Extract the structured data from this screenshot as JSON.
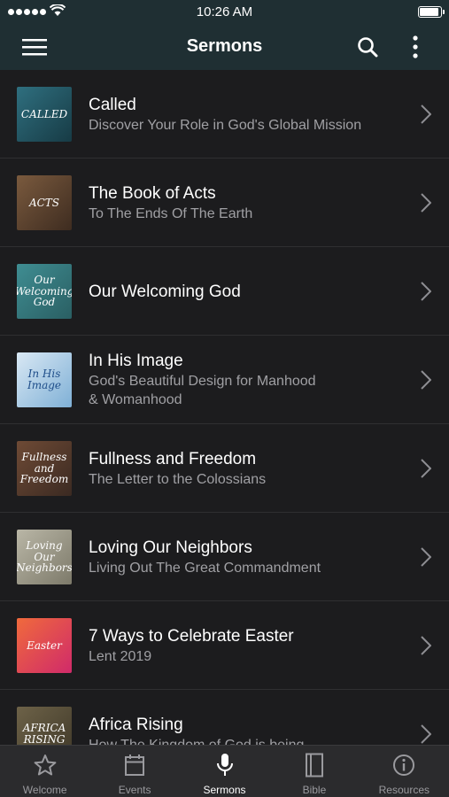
{
  "status_bar": {
    "time": "10:26 AM",
    "battery_level": 0.95
  },
  "header": {
    "title": "Sermons"
  },
  "sermons": [
    {
      "title": "Called",
      "subtitle": "Discover Your Role in God's Global Mission",
      "thumb_text": "CALLED",
      "thumb_colors": [
        "#2f6f7f",
        "#173b45"
      ]
    },
    {
      "title": "The Book of Acts",
      "subtitle": "To The Ends Of The Earth",
      "thumb_text": "ACTS",
      "thumb_colors": [
        "#7a5a3e",
        "#3e2c20"
      ]
    },
    {
      "title": "Our Welcoming God",
      "subtitle": "",
      "thumb_text": "Our Welcoming God",
      "thumb_colors": [
        "#3f8d92",
        "#2a5f63"
      ]
    },
    {
      "title": "In His Image",
      "subtitle": "God's Beautiful Design for Manhood\n& Womanhood",
      "thumb_text": "In His Image",
      "thumb_colors": [
        "#d9e8f4",
        "#7fb0d6"
      ]
    },
    {
      "title": "Fullness and Freedom",
      "subtitle": "The Letter to the Colossians",
      "thumb_text": "Fullness and Freedom",
      "thumb_colors": [
        "#6e4a35",
        "#3b2a22"
      ]
    },
    {
      "title": "Loving Our Neighbors",
      "subtitle": "Living Out The Great Commandment",
      "thumb_text": "Loving Our Neighbors",
      "thumb_colors": [
        "#b9b6a6",
        "#7d7a6a"
      ]
    },
    {
      "title": "7 Ways to Celebrate Easter",
      "subtitle": "Lent 2019",
      "thumb_text": "Easter",
      "thumb_colors": [
        "#f06a3c",
        "#d02a6a"
      ]
    },
    {
      "title": "Africa Rising",
      "subtitle": "How The Kingdom of God is being",
      "thumb_text": "AFRICA RISING",
      "thumb_colors": [
        "#6d6248",
        "#3f3828"
      ]
    }
  ],
  "tabs": [
    {
      "label": "Welcome",
      "icon": "star-icon",
      "active": false
    },
    {
      "label": "Events",
      "icon": "calendar-icon",
      "active": false
    },
    {
      "label": "Sermons",
      "icon": "microphone-icon",
      "active": true
    },
    {
      "label": "Bible",
      "icon": "book-icon",
      "active": false
    },
    {
      "label": "Resources",
      "icon": "info-icon",
      "active": false
    }
  ]
}
